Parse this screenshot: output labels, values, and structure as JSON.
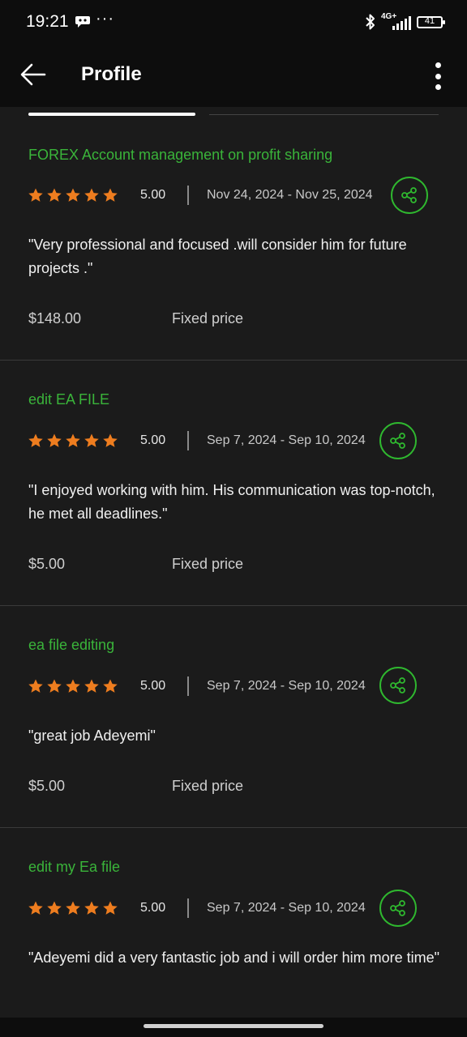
{
  "status": {
    "time": "19:21",
    "more": "···",
    "network": "4G+",
    "battery": "41"
  },
  "header": {
    "title": "Profile"
  },
  "reviews": [
    {
      "title": "FOREX Account management on profit sharing",
      "rating": "5.00",
      "dates": "Nov 24, 2024 - Nov 25, 2024",
      "quote": "\"Very professional and focused .will consider him for future projects .\"",
      "amount": "$148.00",
      "type": "Fixed price"
    },
    {
      "title": "edit EA FILE",
      "rating": "5.00",
      "dates": "Sep 7, 2024 - Sep 10, 2024",
      "quote": "\"I enjoyed working with him. His communication was top-notch, he met all deadlines.\"",
      "amount": "$5.00",
      "type": "Fixed price"
    },
    {
      "title": "ea file editing",
      "rating": "5.00",
      "dates": "Sep 7, 2024 - Sep 10, 2024",
      "quote": "\"great job Adeyemi\"",
      "amount": "$5.00",
      "type": "Fixed price"
    },
    {
      "title": "edit my Ea file",
      "rating": "5.00",
      "dates": "Sep 7, 2024 - Sep 10, 2024",
      "quote": "\"Adeyemi did a very fantastic job and i will order him more time\""
    }
  ],
  "colors": {
    "accent": "#3ab43a",
    "star": "#ee7d1f",
    "background": "#1b1b1b",
    "bar": "#0d0d0d"
  },
  "icons": [
    "back-arrow-icon",
    "more-vert-icon",
    "star-icon",
    "share-icon",
    "bluetooth-icon",
    "signal-icon",
    "battery-icon"
  ]
}
